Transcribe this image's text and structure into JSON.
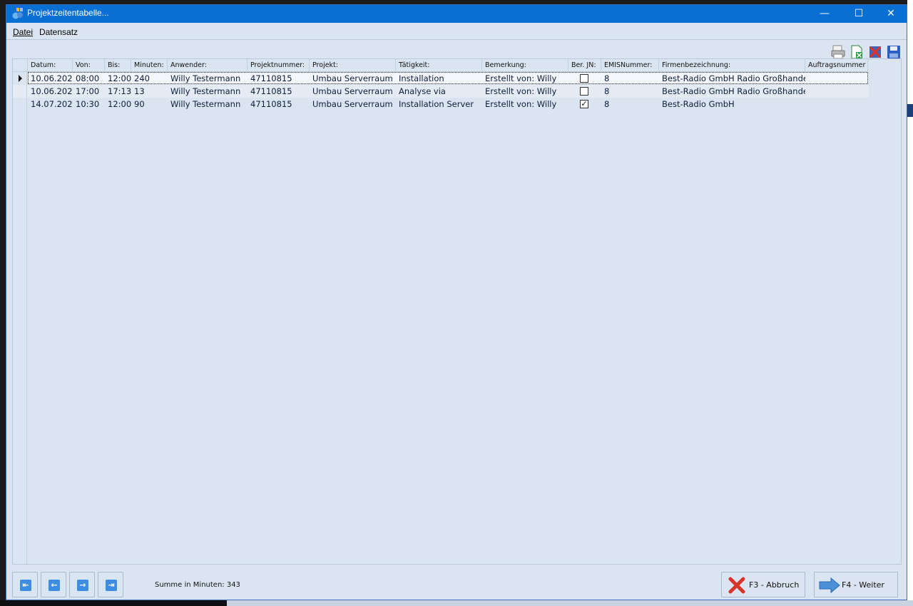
{
  "window": {
    "title": "Projektzeitentabelle...",
    "minimize_label": "—",
    "maximize_label": "☐",
    "close_label": "✕"
  },
  "menu": {
    "datei": "Datei",
    "datensatz": "Datensatz"
  },
  "table": {
    "columns": [
      "Datum:",
      "Von:",
      "Bis:",
      "Minuten:",
      "Anwender:",
      "Projektnummer:",
      "Projekt:",
      "Tätigkeit:",
      "Bemerkung:",
      "Ber. JN:",
      "EMISNummer:",
      "Firmenbezeichnung:",
      "Auftragsnummer"
    ],
    "rows": [
      {
        "datum": "10.06.202",
        "von": "08:00",
        "bis": "12:00",
        "minuten": "240",
        "anwender": "Willy Testermann",
        "projektnummer": "47110815",
        "projekt": "Umbau Serverraum",
        "taetigkeit": "Installation",
        "bemerkung": "Erstellt von: Willy",
        "ber": false,
        "emis": "8",
        "firma": "Best-Radio GmbH Radio Großhandel",
        "auftrag": "",
        "selected": true
      },
      {
        "datum": "10.06.202",
        "von": "17:00",
        "bis": "17:13",
        "minuten": "13",
        "anwender": "Willy Testermann",
        "projektnummer": "47110815",
        "projekt": "Umbau Serverraum",
        "taetigkeit": "Analyse via",
        "bemerkung": "Erstellt von: Willy",
        "ber": false,
        "emis": "8",
        "firma": "Best-Radio GmbH Radio Großhandel",
        "auftrag": "",
        "selected": false
      },
      {
        "datum": "14.07.202",
        "von": "10:30",
        "bis": "12:00",
        "minuten": "90",
        "anwender": "Willy Testermann",
        "projektnummer": "47110815",
        "projekt": "Umbau Serverraum",
        "taetigkeit": "Installation Server",
        "bemerkung": "Erstellt von: Willy",
        "ber": true,
        "emis": "8",
        "firma": "Best-Radio GmbH",
        "auftrag": "",
        "selected": false
      }
    ]
  },
  "footer": {
    "sum_label": "Summe in Minuten: 343",
    "cancel_label": "F3 - Abbruch",
    "next_label": "F4 - Weiter"
  },
  "icons": {
    "print": "printer-icon",
    "export": "excel-export-icon",
    "delete": "delete-icon",
    "save": "save-icon"
  },
  "colors": {
    "titlebar": "#0a6fd3",
    "window_bg": "#dbe5f1",
    "accent_blue": "#3d8de3",
    "cancel_red": "#d9342b"
  }
}
